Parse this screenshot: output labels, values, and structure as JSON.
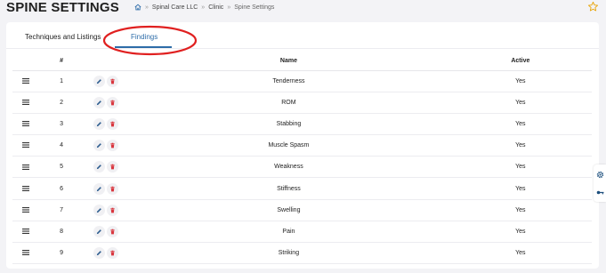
{
  "header": {
    "title": "SPINE SETTINGS",
    "breadcrumb": {
      "separator": "»",
      "items": [
        "Spinal Care LLC",
        "Clinic",
        "Spine Settings"
      ]
    }
  },
  "tabs": [
    {
      "label": "Techniques and Listings",
      "active": false
    },
    {
      "label": "Findings",
      "active": true
    }
  ],
  "table": {
    "columns": [
      "#",
      "Name",
      "Active"
    ],
    "rows": [
      {
        "num": "1",
        "name": "Tenderness",
        "active": "Yes"
      },
      {
        "num": "2",
        "name": "ROM",
        "active": "Yes"
      },
      {
        "num": "3",
        "name": "Stabbing",
        "active": "Yes"
      },
      {
        "num": "4",
        "name": "Muscle Spasm",
        "active": "Yes"
      },
      {
        "num": "5",
        "name": "Weakness",
        "active": "Yes"
      },
      {
        "num": "6",
        "name": "Stiffness",
        "active": "Yes"
      },
      {
        "num": "7",
        "name": "Swelling",
        "active": "Yes"
      },
      {
        "num": "8",
        "name": "Pain",
        "active": "Yes"
      },
      {
        "num": "9",
        "name": "Striking",
        "active": "Yes"
      }
    ]
  },
  "icons": {
    "home": "home-icon",
    "favorite": "star-outline-icon",
    "drag": "drag-handle-icon",
    "edit": "pencil-icon",
    "delete": "trash-icon",
    "settings": "gear-icon",
    "key": "key-icon"
  },
  "colors": {
    "accent": "#2d6ca8",
    "delete": "#d9363e",
    "star": "#e8a200",
    "annotation": "#e02020"
  }
}
